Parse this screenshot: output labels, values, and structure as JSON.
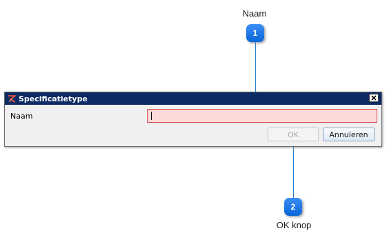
{
  "callouts": [
    {
      "number": "1",
      "label": "Naam"
    },
    {
      "number": "2",
      "label": "OK knop"
    }
  ],
  "dialog": {
    "title": "Specificatietype",
    "icon": "specification-type-icon",
    "close_icon": "close-icon",
    "fields": [
      {
        "label": "Naam",
        "value": "",
        "state": "invalid"
      }
    ],
    "buttons": {
      "ok_label": "OK",
      "ok_enabled": false,
      "cancel_label": "Annuleren"
    }
  },
  "colors": {
    "titlebar": "#0c2a63",
    "callout_badge": "#0a66d9",
    "callout_line": "#2b83d6",
    "invalid_field_bg": "#fcdada",
    "invalid_field_border": "#d84b4b"
  }
}
